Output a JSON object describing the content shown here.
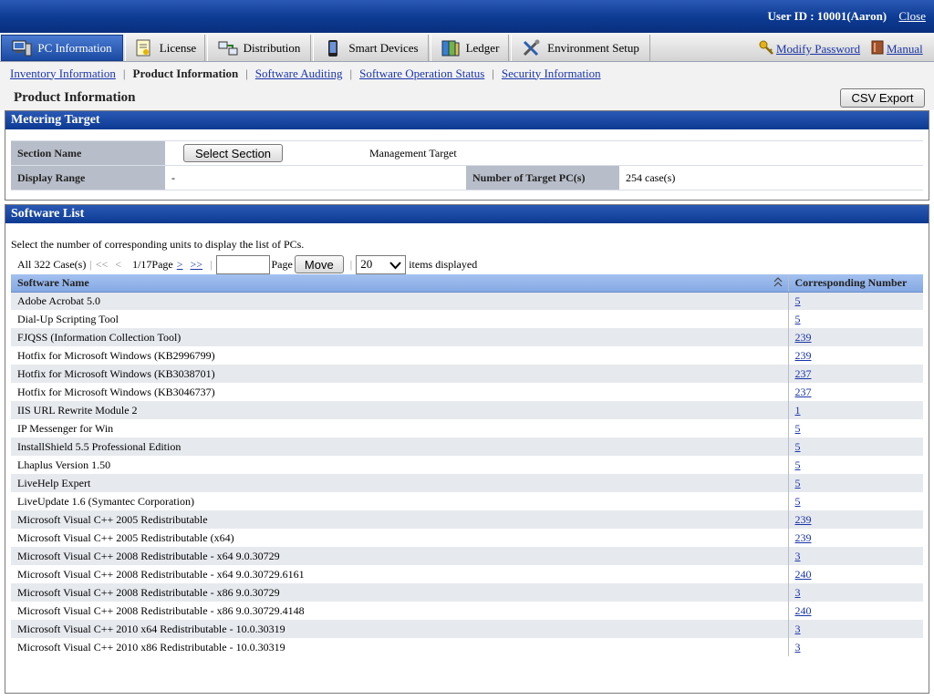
{
  "user": {
    "label": "User ID :",
    "id": "10001(Aaron)",
    "close": "Close"
  },
  "tabs": [
    {
      "label": "PC Information",
      "icon": "pc-icon",
      "active": true
    },
    {
      "label": "License",
      "icon": "license-icon"
    },
    {
      "label": "Distribution",
      "icon": "distribution-icon"
    },
    {
      "label": "Smart Devices",
      "icon": "smartphone-icon"
    },
    {
      "label": "Ledger",
      "icon": "ledger-icon"
    },
    {
      "label": "Environment Setup",
      "icon": "tools-icon"
    }
  ],
  "header_links": {
    "modify_password": "Modify Password",
    "manual": "Manual"
  },
  "subnav": [
    {
      "label": "Inventory Information",
      "link": true
    },
    {
      "label": "Product Information",
      "link": false
    },
    {
      "label": "Software Auditing",
      "link": true
    },
    {
      "label": "Software Operation Status",
      "link": true
    },
    {
      "label": "Security Information",
      "link": true
    }
  ],
  "page_title": "Product Information",
  "csv_button": "CSV Export",
  "metering": {
    "title": "Metering Target",
    "section_name_label": "Section Name",
    "select_section_button": "Select Section",
    "management_target": "Management Target",
    "display_range_label": "Display Range",
    "display_range_value": "-",
    "target_pcs_label": "Number of Target PC(s)",
    "target_pcs_value": "254 case(s)"
  },
  "software": {
    "title": "Software List",
    "instruction": "Select the number of corresponding units to display the list of PCs.",
    "pager": {
      "total": "All 322 Case(s)",
      "first": "<<",
      "prev": "<",
      "page_status": "1/17Page",
      "next": ">",
      "last": ">>",
      "page_input_value": "",
      "page_label": "Page",
      "move_button": "Move",
      "items_per_page": "20",
      "items_label": "items displayed"
    },
    "columns": {
      "name": "Software Name",
      "number": "Corresponding Number"
    },
    "rows": [
      {
        "name": "Adobe Acrobat 5.0",
        "count": "5"
      },
      {
        "name": "Dial-Up Scripting Tool",
        "count": "5"
      },
      {
        "name": "FJQSS (Information Collection Tool)",
        "count": "239"
      },
      {
        "name": "Hotfix for Microsoft Windows (KB2996799)",
        "count": "239"
      },
      {
        "name": "Hotfix for Microsoft Windows (KB3038701)",
        "count": "237"
      },
      {
        "name": "Hotfix for Microsoft Windows (KB3046737)",
        "count": "237"
      },
      {
        "name": "IIS URL Rewrite Module 2",
        "count": "1"
      },
      {
        "name": "IP Messenger for Win",
        "count": "5"
      },
      {
        "name": "InstallShield 5.5 Professional Edition",
        "count": "5"
      },
      {
        "name": "Lhaplus Version 1.50",
        "count": "5"
      },
      {
        "name": "LiveHelp Expert",
        "count": "5"
      },
      {
        "name": "LiveUpdate 1.6 (Symantec Corporation)",
        "count": "5"
      },
      {
        "name": "Microsoft Visual C++ 2005 Redistributable",
        "count": "239"
      },
      {
        "name": "Microsoft Visual C++ 2005 Redistributable (x64)",
        "count": "239"
      },
      {
        "name": "Microsoft Visual C++ 2008 Redistributable - x64 9.0.30729",
        "count": "3"
      },
      {
        "name": "Microsoft Visual C++ 2008 Redistributable - x64 9.0.30729.6161",
        "count": "240"
      },
      {
        "name": "Microsoft Visual C++ 2008 Redistributable - x86 9.0.30729",
        "count": "3"
      },
      {
        "name": "Microsoft Visual C++ 2008 Redistributable - x86 9.0.30729.4148",
        "count": "240"
      },
      {
        "name": "Microsoft Visual C++ 2010  x64 Redistributable - 10.0.30319",
        "count": "3"
      },
      {
        "name": "Microsoft Visual C++ 2010  x86 Redistributable - 10.0.30319",
        "count": "3"
      }
    ]
  }
}
